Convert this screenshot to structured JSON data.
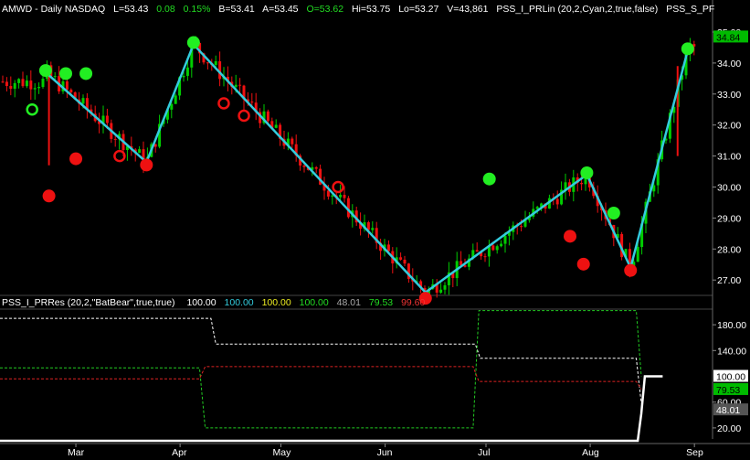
{
  "price_header": {
    "symbol": "AMWD - Daily  NASDAQ",
    "last": "L=53.43",
    "change": "0.08",
    "change_pct": "0.15%",
    "bid": "B=53.41",
    "ask": "A=53.45",
    "open": "O=53.62",
    "high": "Hi=53.75",
    "low": "Lo=53.27",
    "volume": "V=43,861",
    "indicator_1": "PSS_I_PRLin (20,2,Cyan,2,true,false)",
    "indicator_2": "PSS_S_PF"
  },
  "lower_header": {
    "study": "PSS_I_PRRes (20,2,\"BatBear\",true,true)",
    "v1": "100.00",
    "v2": "100.00",
    "v3": "100.00",
    "v4": "100.00",
    "v5": "48.01",
    "v6": "79.53",
    "v7": "99.60"
  },
  "price_axis": {
    "ticks": [
      "35.00",
      "34.00",
      "33.00",
      "32.00",
      "31.00",
      "30.00",
      "29.00",
      "28.00",
      "27.00"
    ],
    "last_price_label": "34.84"
  },
  "lower_axis": {
    "ticks": [
      "180.00",
      "140.00",
      "60.00",
      "20.00"
    ],
    "markers": [
      "100.00",
      "79.53",
      "48.01"
    ]
  },
  "time_axis": {
    "labels": [
      "Mar",
      "Apr",
      "May",
      "Jun",
      "Jul",
      "Aug",
      "Sep"
    ]
  },
  "colors": {
    "up": "#00cc00",
    "down": "#ee1111",
    "zigzag": "#33ccdd",
    "swing_high": "#22ee22",
    "swing_low": "#ee1111",
    "lower_white": "#ffffff",
    "lower_green": "#22cc22",
    "lower_red": "#dd2222",
    "axis_text": "#ffffff",
    "header_text": "#ffffff",
    "header_green": "#22dd22",
    "header_cyan": "#33ccdd",
    "header_yellow": "#eeee22",
    "header_red": "#ee3333"
  },
  "chart_data": [
    {
      "type": "candlestick",
      "title": "AMWD - Daily  NASDAQ",
      "ylim": [
        26.5,
        35.5
      ],
      "x_months": [
        "Mar",
        "Apr",
        "May",
        "Jun",
        "Jul",
        "Aug",
        "Sep"
      ],
      "zigzag": {
        "name": "PSS_I_PRLin",
        "points": [
          {
            "date": "Feb 20",
            "value": 33.7
          },
          {
            "date": "Mar 22",
            "value": 30.8
          },
          {
            "date": "Apr 5",
            "value": 34.6
          },
          {
            "date": "Jun 13",
            "value": 26.6
          },
          {
            "date": "Jul 31",
            "value": 30.4
          },
          {
            "date": "Aug 13",
            "value": 27.4
          },
          {
            "date": "Aug 30",
            "value": 34.4
          }
        ]
      },
      "swing_high_markers": [
        {
          "date": "Feb 20",
          "value": 33.7
        },
        {
          "date": "Feb 26",
          "value": 33.6
        },
        {
          "date": "Mar 4",
          "value": 33.6
        },
        {
          "date": "Apr 5",
          "value": 34.6
        },
        {
          "date": "Jul 2",
          "value": 30.2
        },
        {
          "date": "Jul 31",
          "value": 30.4
        },
        {
          "date": "Aug 8",
          "value": 29.1
        },
        {
          "date": "Aug 30",
          "value": 34.4
        }
      ],
      "swing_low_markers": [
        {
          "date": "Feb 21",
          "value": 29.8
        },
        {
          "date": "Mar 1",
          "value": 31.0
        },
        {
          "date": "Mar 14",
          "value": 31.0
        },
        {
          "date": "Mar 22",
          "value": 30.8
        },
        {
          "date": "Apr 14",
          "value": 32.7
        },
        {
          "date": "Apr 20",
          "value": 32.3
        },
        {
          "date": "May 18",
          "value": 30.0
        },
        {
          "date": "Jun 13",
          "value": 26.5
        },
        {
          "date": "Jul 26",
          "value": 28.5
        },
        {
          "date": "Jul 30",
          "value": 27.6
        },
        {
          "date": "Aug 13",
          "value": 27.4
        }
      ],
      "open_circle_markers": [
        {
          "date": "Feb 16",
          "value": 32.5,
          "color": "#22ee22"
        },
        {
          "date": "Mar 14",
          "value": 31.0,
          "color": "#ee1111"
        },
        {
          "date": "Apr 14",
          "value": 32.7,
          "color": "#ee1111"
        },
        {
          "date": "Apr 20",
          "value": 32.3,
          "color": "#ee1111"
        },
        {
          "date": "May 18",
          "value": 30.0,
          "color": "#ee1111"
        }
      ],
      "filled_marker_dates_high": [
        "Feb 20",
        "Feb 26",
        "Mar 4",
        "Apr 5",
        "Jul 2",
        "Jul 31",
        "Aug 8",
        "Aug 30"
      ],
      "filled_marker_dates_low": [
        "Feb 21",
        "Mar 1",
        "Mar 22",
        "Jun 13",
        "Jul 26",
        "Jul 30",
        "Aug 13"
      ],
      "last_price": 34.84
    },
    {
      "type": "line",
      "title": "PSS_I_PRRes (20,2,\"BatBear\",true,true)",
      "ylim": [
        0,
        210
      ],
      "series": [
        {
          "color": "white",
          "style": "dashed",
          "points": [
            [
              0,
              190
            ],
            [
              0.296,
              190
            ],
            [
              0.303,
              150
            ],
            [
              0.667,
              150
            ],
            [
              0.674,
              128
            ],
            [
              0.893,
              128
            ],
            [
              0.9,
              58
            ]
          ]
        },
        {
          "color": "green",
          "style": "dashed",
          "points": [
            [
              0,
              113
            ],
            [
              0.28,
              113
            ],
            [
              0.288,
              20
            ],
            [
              0.664,
              20
            ],
            [
              0.672,
              202
            ],
            [
              0.893,
              202
            ],
            [
              0.9,
              100
            ]
          ]
        },
        {
          "color": "red",
          "style": "dashed",
          "points": [
            [
              0,
              96
            ],
            [
              0.28,
              96
            ],
            [
              0.288,
              115
            ],
            [
              0.664,
              115
            ],
            [
              0.672,
              92
            ],
            [
              0.893,
              92
            ],
            [
              0.9,
              80
            ]
          ]
        },
        {
          "color": "white",
          "style": "solid",
          "points": [
            [
              0,
              0
            ],
            [
              0.895,
              0
            ],
            [
              0.9,
              42
            ],
            [
              0.905,
              100
            ],
            [
              0.93,
              100
            ]
          ]
        }
      ],
      "last_values": [
        100.0,
        79.53,
        48.01
      ]
    }
  ]
}
